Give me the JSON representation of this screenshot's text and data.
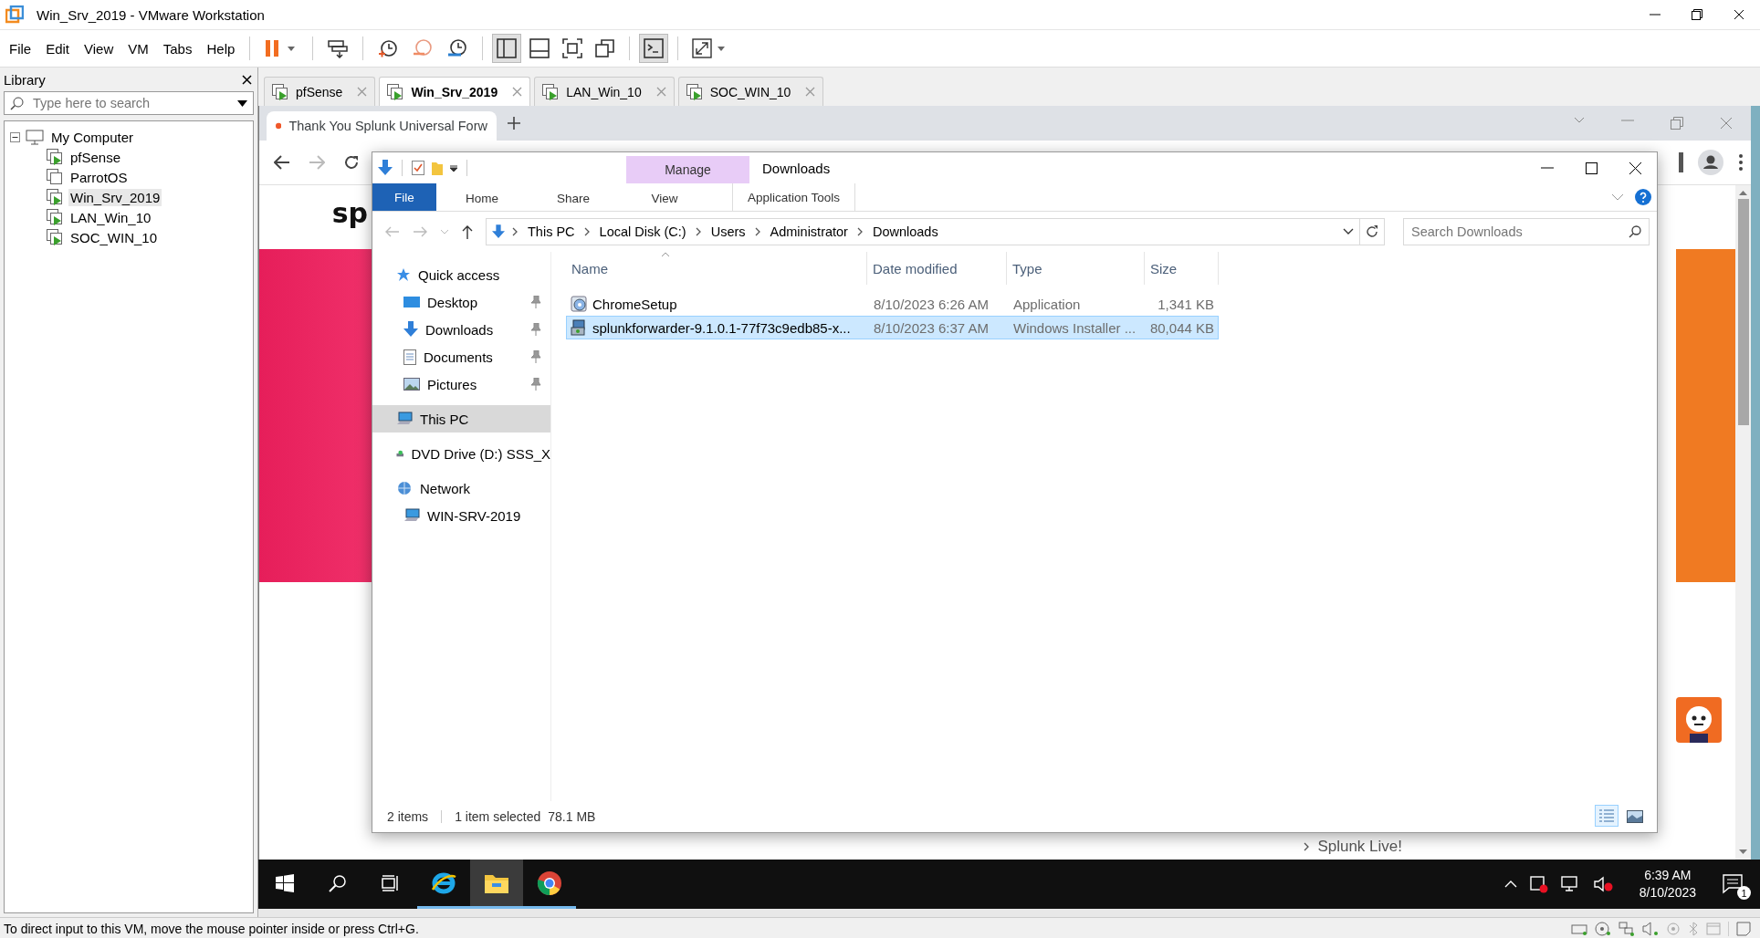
{
  "window": {
    "title": "Win_Srv_2019 - VMware Workstation"
  },
  "menu": [
    "File",
    "Edit",
    "View",
    "VM",
    "Tabs",
    "Help"
  ],
  "library": {
    "title": "Library",
    "search": {
      "placeholder": "Type here to search"
    },
    "tree": [
      {
        "label": "My Computer",
        "expanded": true,
        "children": [
          {
            "label": "pfSense",
            "running": true,
            "selected": false
          },
          {
            "label": "ParrotOS",
            "running": false,
            "selected": false
          },
          {
            "label": "Win_Srv_2019",
            "running": true,
            "selected": true
          },
          {
            "label": "LAN_Win_10",
            "running": true,
            "selected": false
          },
          {
            "label": "SOC_WIN_10",
            "running": true,
            "selected": false
          }
        ]
      }
    ]
  },
  "vm_tabs": [
    {
      "label": "pfSense",
      "selected": false
    },
    {
      "label": "Win_Srv_2019",
      "selected": true
    },
    {
      "label": "LAN_Win_10",
      "selected": false
    },
    {
      "label": "SOC_WIN_10",
      "selected": false
    }
  ],
  "browser": {
    "tab_title": "Thank You Splunk Universal Forw",
    "page_logo": "sp",
    "page_link": "Splunk Live!"
  },
  "explorer": {
    "context_group": "Manage",
    "title": "Downloads",
    "ribbon_tabs": [
      {
        "label": "File",
        "kind": "file"
      },
      {
        "label": "Home",
        "kind": "tab"
      },
      {
        "label": "Share",
        "kind": "tab"
      },
      {
        "label": "View",
        "kind": "tab"
      },
      {
        "label": "Application Tools",
        "kind": "contextual"
      }
    ],
    "address": [
      "This PC",
      "Local Disk (C:)",
      "Users",
      "Administrator",
      "Downloads"
    ],
    "search": {
      "placeholder": "Search Downloads"
    },
    "nav": [
      {
        "label": "Quick access",
        "kind": "star",
        "selected": false,
        "children": [
          {
            "label": "Desktop",
            "kind": "desktop",
            "pinned": true,
            "selected": false
          },
          {
            "label": "Downloads",
            "kind": "download",
            "pinned": true,
            "selected": false
          },
          {
            "label": "Documents",
            "kind": "documents",
            "pinned": true,
            "selected": false
          },
          {
            "label": "Pictures",
            "kind": "pictures",
            "pinned": true,
            "selected": false
          }
        ]
      },
      {
        "label": "This PC",
        "kind": "computer",
        "selected": true
      },
      {
        "label": "DVD Drive (D:) SSS_X",
        "kind": "dvd",
        "selected": false
      },
      {
        "label": "Network",
        "kind": "network",
        "selected": false,
        "children": [
          {
            "label": "WIN-SRV-2019",
            "kind": "computer",
            "selected": false
          }
        ]
      }
    ],
    "columns": [
      "Name",
      "Date modified",
      "Type",
      "Size"
    ],
    "rows": [
      {
        "name": "ChromeSetup",
        "date": "8/10/2023 6:26 AM",
        "type": "Application",
        "size": "1,341 KB",
        "selected": false
      },
      {
        "name": "splunkforwarder-9.1.0.1-77f73c9edb85-x...",
        "date": "8/10/2023 6:37 AM",
        "type": "Windows Installer ...",
        "size": "80,044 KB",
        "selected": true
      }
    ],
    "status": {
      "count": "2 items",
      "selection": "1 item selected",
      "selection_size": "78.1 MB"
    }
  },
  "taskbar": {
    "apps": [
      {
        "selected": false
      },
      {
        "selected": true
      },
      {
        "selected": false
      }
    ],
    "time": "6:39 AM",
    "date": "8/10/2023",
    "notifications": "1"
  },
  "status_bar": "To direct input to this VM, move the mouse pointer inside or press Ctrl+G."
}
